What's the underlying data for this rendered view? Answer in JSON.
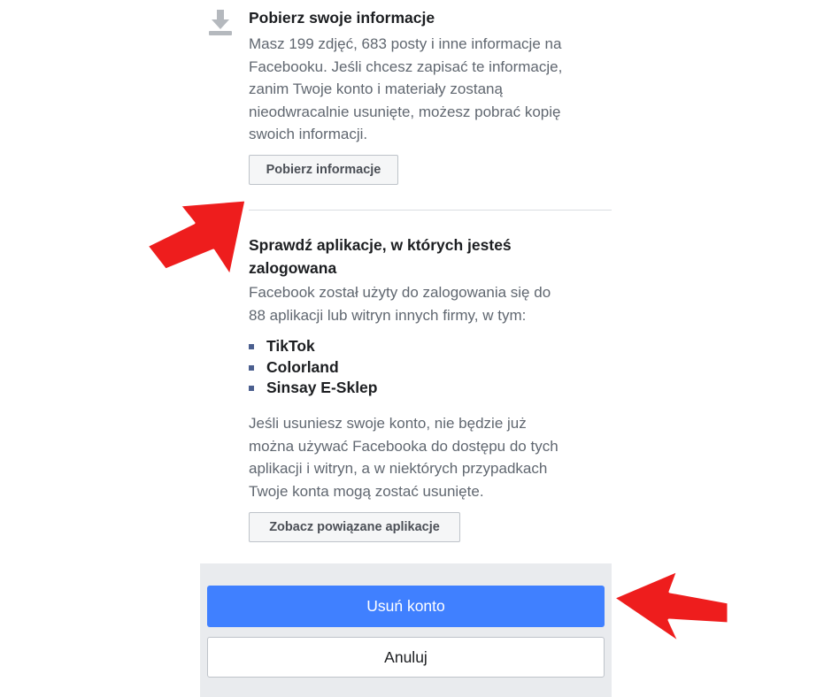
{
  "download_section": {
    "icon": "download-icon",
    "title": "Pobierz swoje informacje",
    "description_lines": [
      "Masz 199 zdjęć, 683 posty i inne informacje na",
      "Facebooku. Jeśli chcesz zapisać te informacje,",
      "zanim Twoje konto i materiały zostaną",
      "nieodwracalnie usunięte, możesz pobrać kopię",
      "swoich informacji."
    ],
    "button_label": "Pobierz informacje"
  },
  "apps_section": {
    "icon": "app-icon",
    "title_lines": [
      "Sprawdź aplikacje, w których jesteś",
      "zalogowana"
    ],
    "intro_lines": [
      "Facebook został użyty do zalogowania się do",
      "88 aplikacji lub witryn innych firmy, w tym:"
    ],
    "apps": [
      "TikTok",
      "Colorland",
      "Sinsay E-Sklep"
    ],
    "warning_lines": [
      "Jeśli usuniesz swoje konto, nie będzie już",
      "można używać Facebooka do dostępu do tych",
      "aplikacji i witryn, a w niektórych przypadkach",
      "Twoje konta mogą zostać usunięte."
    ],
    "button_label": "Zobacz powiązane aplikacje"
  },
  "footer": {
    "delete_label": "Usuń konto",
    "cancel_label": "Anuluj"
  },
  "colors": {
    "primary_button": "#4080ff",
    "annotation_arrow": "#ee1d1d",
    "footer_background": "#e9ebee"
  }
}
